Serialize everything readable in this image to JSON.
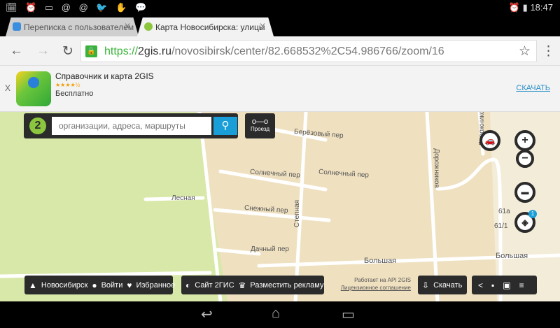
{
  "status_bar": {
    "time": "18:47",
    "left_icons": "🗓 ⏰ ▭ @ @ 🐦 ✋ 💬",
    "right_icons": "⏰ ▮"
  },
  "tabs": [
    {
      "title": "Переписка с пользователем",
      "close": "X"
    },
    {
      "title": "Карта Новосибирска: улицы",
      "close": "X"
    }
  ],
  "toolbar": {
    "back": "←",
    "forward": "→",
    "reload": "↻",
    "url_scheme": "https://",
    "url_host": "2gis.ru",
    "url_path": "/novosibirsk/center/82.668532%2C54.986766/zoom/16",
    "star": "☆",
    "menu": "⋮"
  },
  "banner": {
    "title": "Справочник и карта 2GIS",
    "stars": "★★★★½",
    "price": "Бесплатно",
    "action": "СКАЧАТЬ",
    "close": "X"
  },
  "map": {
    "search_placeholder": "организации, адреса, маршруты",
    "route_label": "Проезд",
    "layers_badge": "1",
    "streets": [
      "Берёзовый пер",
      "Солнечный пер",
      "Солнечный пер",
      "Лесная",
      "Снежный пер",
      "Степная",
      "Дачный пер",
      "Большая",
      "Большая",
      "Дорожников",
      "Дорожников",
      "61а",
      "61/1"
    ],
    "bottom_left": {
      "city": "Новосибирск",
      "login": "Войти",
      "favorites": "Избранное"
    },
    "bottom_mid": {
      "site": "Сайт 2ГИС",
      "ads": "Разместить рекламу"
    },
    "api": "Работает на API 2GIS",
    "license": "Лицензионное соглашение",
    "download": "Скачать"
  },
  "colors": {
    "accent": "#1a9ed8",
    "green": "#3bb33b",
    "panel": "#2b2b2b",
    "map_bg": "#efe0c0",
    "park": "#d8e8a8"
  }
}
